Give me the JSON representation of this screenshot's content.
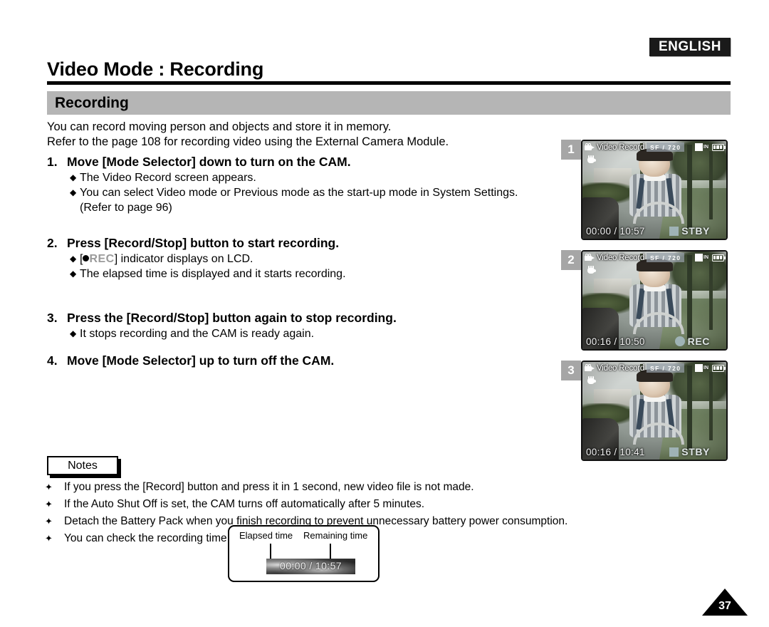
{
  "header": {
    "language_badge": "ENGLISH",
    "page_title": "Video Mode : Recording",
    "section_title": "Recording"
  },
  "intro": {
    "line1": "You can record moving person and objects and store it in memory.",
    "line2": "Refer to the page 108 for recording video using the External Camera Module."
  },
  "steps": [
    {
      "number": "1.",
      "title": "Move [Mode Selector] down to turn on the CAM.",
      "bullets": [
        {
          "marker": "◆",
          "text": "The Video Record screen appears."
        },
        {
          "marker": "◆",
          "text": "You can select Video mode or Previous mode as the start-up mode in System Settings."
        }
      ],
      "continuation": "(Refer to page 96)"
    },
    {
      "number": "2.",
      "title": "Press [Record/Stop] button to start recording.",
      "bullets": [
        {
          "marker": "◆",
          "prefix": "[",
          "dot": true,
          "rec_word": "REC",
          "text": "] indicator displays on LCD."
        },
        {
          "marker": "◆",
          "text": "The elapsed time is displayed and it starts recording."
        }
      ]
    },
    {
      "number": "3.",
      "title": "Press the [Record/Stop] button again to stop recording.",
      "bullets": [
        {
          "marker": "◆",
          "text": "It stops recording and the CAM is ready again."
        }
      ]
    },
    {
      "number": "4.",
      "title": "Move [Mode Selector] up to turn off the CAM.",
      "bullets": []
    }
  ],
  "notes": {
    "tab_label": "Notes",
    "marker": "✦",
    "items": [
      "If you press the [Record] button and press it in 1 second, new video file is not made.",
      "If the Auto Shut Off is set, the CAM turns off automatically after 5 minutes.",
      "Detach the Battery Pack when you finish recording to prevent unnecessary battery power consumption.",
      "You can check the recording time."
    ]
  },
  "callout": {
    "label_left": "Elapsed time",
    "label_right": "Remaining time",
    "time_display": "00:00 / 10:57"
  },
  "screens": [
    {
      "index": "1",
      "osd_title": "Video Record",
      "quality": "SF  /  720",
      "memory": "IN",
      "time": "00:00 / 10:57",
      "state": "STBY",
      "state_shape": "square"
    },
    {
      "index": "2",
      "osd_title": "Video Record",
      "quality": "SF  /  720",
      "memory": "IN",
      "time": "00:16 / 10:50",
      "state": "REC",
      "state_shape": "circle"
    },
    {
      "index": "3",
      "osd_title": "Video Record",
      "quality": "SF  /  720",
      "memory": "IN",
      "time": "00:16 / 10:41",
      "state": "STBY",
      "state_shape": "square"
    }
  ],
  "footer": {
    "page_number": "37"
  },
  "colors": {
    "section_bar": "#b5b5b5",
    "badge_bg": "#1a1a1a",
    "index_badge": "#a6a6a6",
    "rec_word": "#9a9a9a"
  }
}
